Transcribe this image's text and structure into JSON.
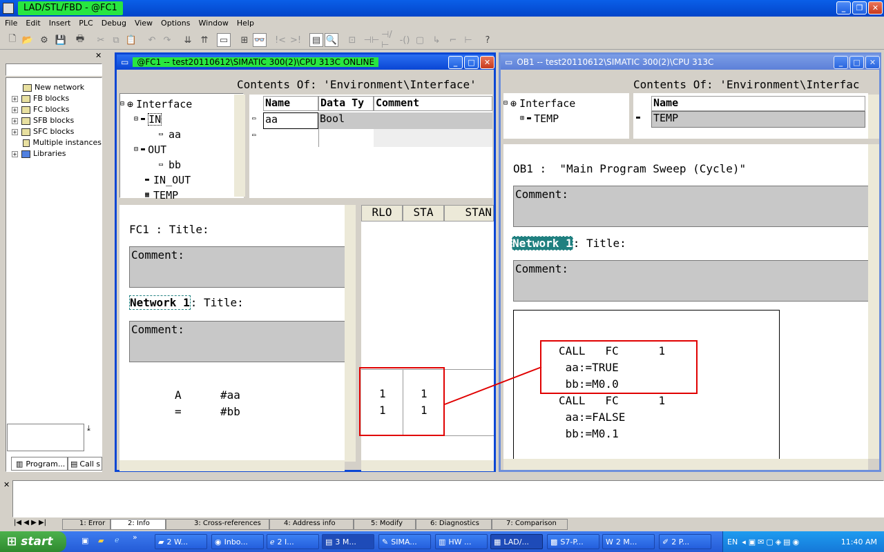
{
  "app": {
    "title": "LAD/STL/FBD  - @FC1"
  },
  "menu": [
    "File",
    "Edit",
    "Insert",
    "PLC",
    "Debug",
    "View",
    "Options",
    "Window",
    "Help"
  ],
  "left_panel": {
    "tree": [
      "New network",
      "FB blocks",
      "FC blocks",
      "SFB blocks",
      "SFC blocks",
      "Multiple instances",
      "Libraries"
    ],
    "tabs": [
      "Program...",
      "Call s"
    ]
  },
  "fc1_window": {
    "title": "@FC1 -- test20110612\\SIMATIC 300(2)\\CPU 313C  ONLINE",
    "contents_label": "Contents Of: 'Environment\\Interface'",
    "interface_tree": {
      "root": "Interface",
      "items": [
        "IN",
        "aa",
        "OUT",
        "bb",
        "IN_OUT",
        "TEMP"
      ]
    },
    "table": {
      "headers": [
        "Name",
        "Data Ty",
        "Comment"
      ],
      "row": {
        "name": "aa",
        "type": "Bool"
      }
    },
    "code": {
      "block_title": "FC1 : Title:",
      "comment": "Comment:",
      "network": "Network 1",
      "network_title": ": Title:",
      "comment2": "Comment:",
      "line1_op": "A",
      "line1_arg": "#aa",
      "line2_op": "=",
      "line2_arg": "#bb"
    },
    "status": {
      "headers": [
        "RLO",
        "STA",
        "STAN"
      ],
      "rows": [
        [
          "1",
          "1"
        ],
        [
          "1",
          "1"
        ]
      ]
    }
  },
  "ob1_window": {
    "title": "OB1 -- test20110612\\SIMATIC 300(2)\\CPU 313C",
    "contents_label": "Contents Of: 'Environment\\Interfac",
    "interface_tree": {
      "root": "Interface",
      "items": [
        "TEMP"
      ]
    },
    "table": {
      "header": "Name",
      "row": "TEMP"
    },
    "code": {
      "block_title": "OB1 :  \"Main Program Sweep (Cycle)\"",
      "comment": "Comment:",
      "network": "Network 1",
      "network_title": ": Title:",
      "comment2": "Comment:",
      "lines": [
        "CALL   FC      1",
        " aa:=TRUE",
        " bb:=M0.0",
        "CALL   FC      1",
        " aa:=FALSE",
        " bb:=M0.1"
      ]
    }
  },
  "bottom_tabs": [
    "1: Error",
    "2: Info",
    "3: Cross-references",
    "4: Address info",
    "5: Modify",
    "6: Diagnostics",
    "7: Comparison"
  ],
  "taskbar": {
    "start": "start",
    "items": [
      "2 W...",
      "Inbo...",
      "2 I...",
      "3 M...",
      "SIMA...",
      "HW ...",
      "LAD/...",
      "S7-P...",
      "2 M...",
      "2 P..."
    ],
    "lang": "EN",
    "clock": "11:40 AM"
  }
}
